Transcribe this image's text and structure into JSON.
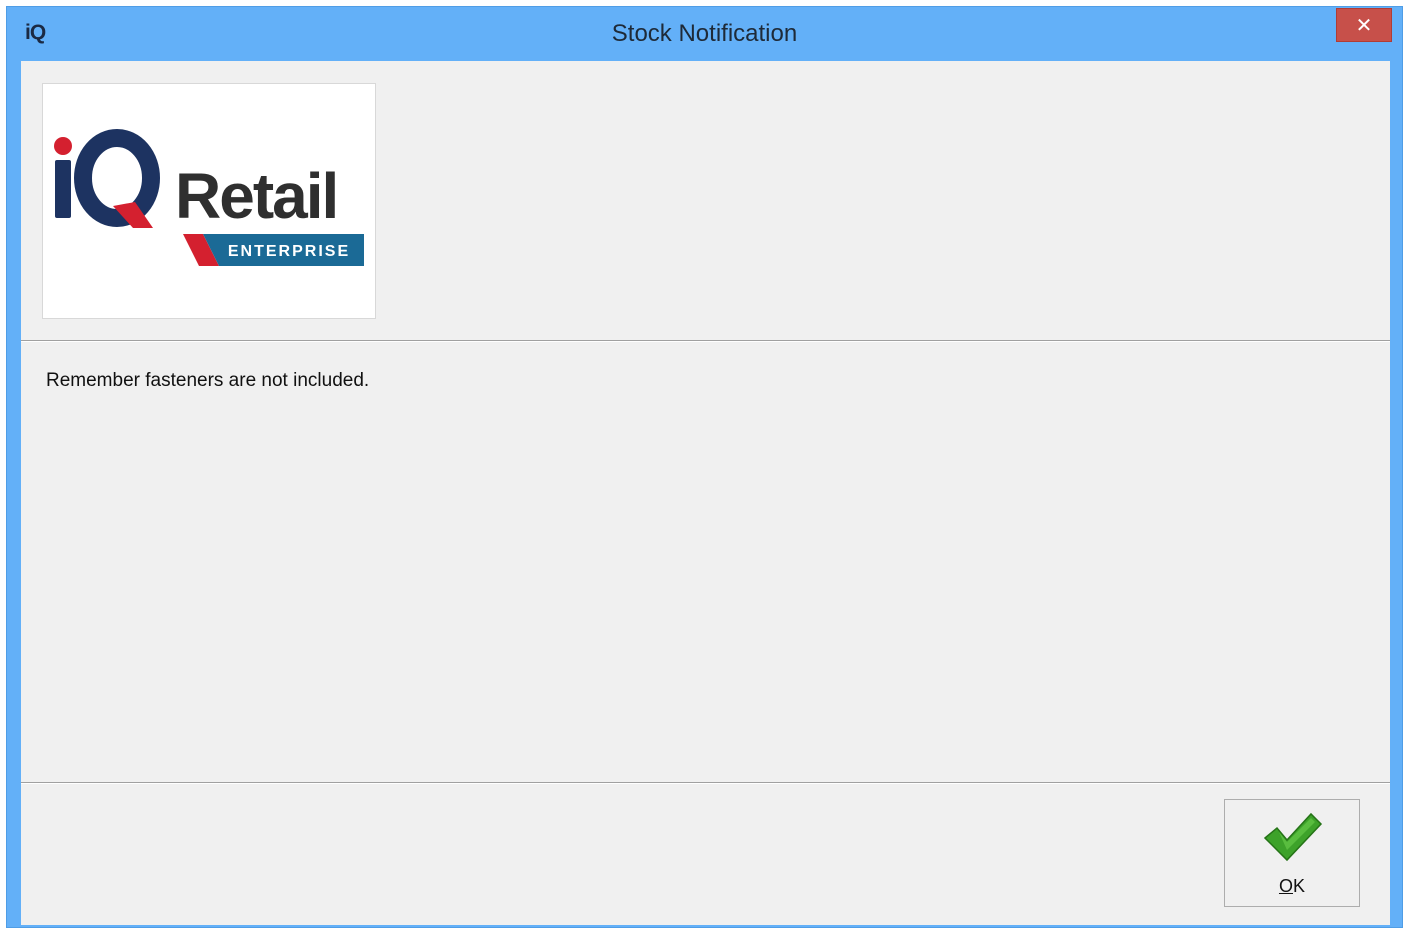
{
  "window": {
    "title": "Stock Notification",
    "app_icon_text": "iQ",
    "close_glyph": "✕"
  },
  "logo": {
    "brand_main": "iQ",
    "brand_word": "Retail",
    "brand_sub": "ENTERPRISE",
    "colors": {
      "navy": "#1d3361",
      "red": "#d4202f",
      "dark_text": "#2f2f2f",
      "teal": "#1b6a96"
    }
  },
  "message": {
    "text": "Remember fasteners are not included."
  },
  "ok_button": {
    "mnemonic": "O",
    "rest": "K",
    "icon": "green-checkmark-icon"
  },
  "colors": {
    "titlebar": "#63b0f8",
    "close_button": "#c7504a",
    "client_bg": "#f0f0f0",
    "check_green": "#3da22a"
  }
}
